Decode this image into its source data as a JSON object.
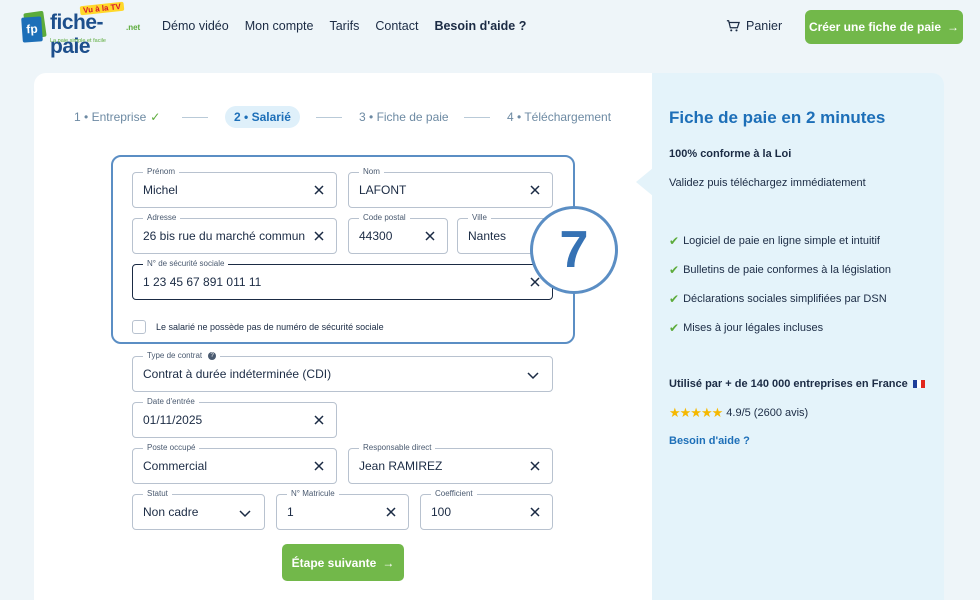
{
  "header": {
    "logo_word": "fiche-paie",
    "logo_net": ".net",
    "logo_tv": "Vu à la TV",
    "logo_tag": "La paie simple et facile",
    "logo_mark": "fp",
    "nav": [
      "Démo vidéo",
      "Mon compte",
      "Tarifs",
      "Contact",
      "Besoin d'aide ?"
    ],
    "cart_label": "Panier",
    "cta_label": "Créer une fiche de paie"
  },
  "steps": [
    {
      "num": "1",
      "label": "Entreprise",
      "done": true
    },
    {
      "num": "2",
      "label": "Salarié",
      "active": true
    },
    {
      "num": "3",
      "label": "Fiche de paie"
    },
    {
      "num": "4",
      "label": "Téléchargement"
    }
  ],
  "form": {
    "prenom": {
      "label": "Prénom",
      "value": "Michel"
    },
    "nom": {
      "label": "Nom",
      "value": "LAFONT"
    },
    "adresse": {
      "label": "Adresse",
      "value": "26 bis rue du marché commun"
    },
    "cp": {
      "label": "Code postal",
      "value": "44300"
    },
    "ville": {
      "label": "Ville",
      "value": "Nantes"
    },
    "secu": {
      "label": "N° de sécurité sociale",
      "value": "1 23 45 67 891 011 11"
    },
    "no_secu_label": "Le salarié ne possède pas de numéro de sécurité sociale",
    "contrat": {
      "label": "Type de contrat",
      "value": "Contrat à durée indéterminée (CDI)"
    },
    "date": {
      "label": "Date d'entrée",
      "value": "01/11/2025"
    },
    "poste": {
      "label": "Poste occupé",
      "value": "Commercial"
    },
    "responsable": {
      "label": "Responsable direct",
      "value": "Jean RAMIREZ"
    },
    "statut": {
      "label": "Statut",
      "value": "Non cadre"
    },
    "matricule": {
      "label": "N° Matricule",
      "value": "1"
    },
    "coefficient": {
      "label": "Coefficient",
      "value": "100"
    },
    "next_label": "Étape suivante"
  },
  "badge": "7",
  "sidebar": {
    "title": "Fiche de paie en 2 minutes",
    "subtitle": "100% conforme à la Loi",
    "desc": "Validez puis téléchargez immédiatement",
    "features": [
      "Logiciel de paie en ligne simple et intuitif",
      "Bulletins de paie conformes à la législation",
      "Déclarations sociales simplifiées par DSN",
      "Mises à jour légales incluses"
    ],
    "used_by": "Utilisé par + de 140 000 entreprises en France",
    "stars": "★★★★★",
    "rating": "4.9/5 (2600 avis)",
    "help": "Besoin d'aide ?"
  },
  "colors": {
    "green": "#72b84a",
    "blue": "#1d6fb8",
    "highlight": "#5b8ec4"
  }
}
